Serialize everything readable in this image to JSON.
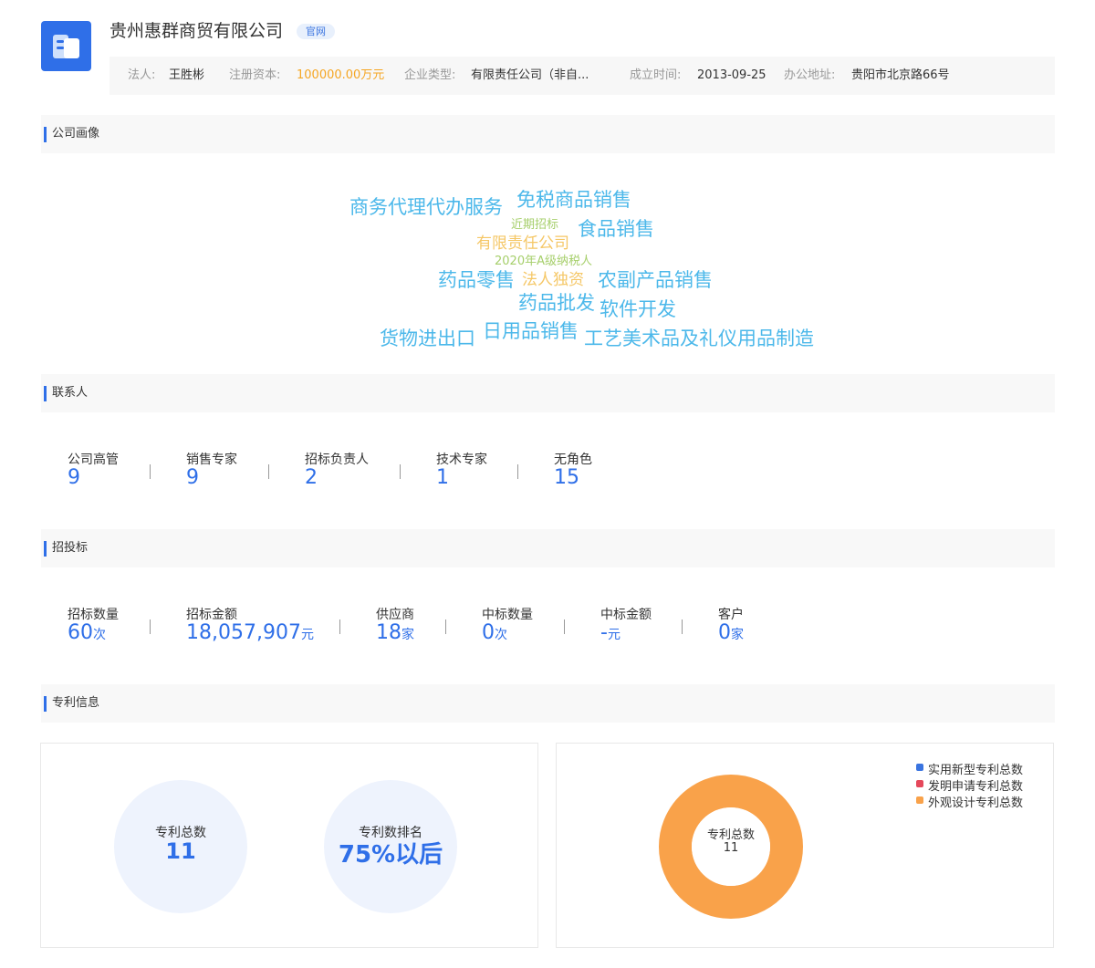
{
  "header": {
    "company_name": "贵州惠群商贸有限公司",
    "official_badge": "官网",
    "legal_person_label": "法人:",
    "legal_person": "王胜彬",
    "capital_label": "注册资本:",
    "capital": "100000.00万元",
    "type_label": "企业类型:",
    "type": "有限责任公司（非自...",
    "founded_label": "成立时间:",
    "founded": "2013-09-25",
    "address_label": "办公地址:",
    "address": "贵阳市北京路66号"
  },
  "portrait": {
    "title": "公司画像",
    "words": [
      {
        "text": "商务代理代办服务",
        "color": "#4cb8ea"
      },
      {
        "text": "免税商品销售",
        "color": "#4cb8ea"
      },
      {
        "text": "近期招标",
        "color": "#a6cf6b"
      },
      {
        "text": "食品销售",
        "color": "#4cb8ea"
      },
      {
        "text": "有限责任公司",
        "color": "#f5c766"
      },
      {
        "text": "2020年A级纳税人",
        "color": "#a6cf6b"
      },
      {
        "text": "药品零售",
        "color": "#4cb8ea"
      },
      {
        "text": "法人独资",
        "color": "#f5c766"
      },
      {
        "text": "农副产品销售",
        "color": "#4cb8ea"
      },
      {
        "text": "药品批发",
        "color": "#4cb8ea"
      },
      {
        "text": "软件开发",
        "color": "#4cb8ea"
      },
      {
        "text": "货物进出口",
        "color": "#4cb8ea"
      },
      {
        "text": "日用品销售",
        "color": "#4cb8ea"
      },
      {
        "text": "工艺美术品及礼仪用品制造",
        "color": "#4cb8ea"
      }
    ]
  },
  "contacts": {
    "title": "联系人",
    "items": [
      {
        "label": "公司高管",
        "value": "9"
      },
      {
        "label": "销售专家",
        "value": "9"
      },
      {
        "label": "招标负责人",
        "value": "2"
      },
      {
        "label": "技术专家",
        "value": "1"
      },
      {
        "label": "无角色",
        "value": "15"
      }
    ]
  },
  "bidding": {
    "title": "招投标",
    "items": [
      {
        "label": "招标数量",
        "value": "60",
        "unit": "次"
      },
      {
        "label": "招标金额",
        "value": "18,057,907",
        "unit": "元"
      },
      {
        "label": "供应商",
        "value": "18",
        "unit": "家"
      },
      {
        "label": "中标数量",
        "value": "0",
        "unit": "次"
      },
      {
        "label": "中标金额",
        "value": "-",
        "unit": "元"
      },
      {
        "label": "客户",
        "value": "0",
        "unit": "家"
      }
    ]
  },
  "patent": {
    "title": "专利信息",
    "total_label": "专利总数",
    "total_value": "11",
    "rank_label": "专利数排名",
    "rank_value": "75%以后",
    "donut_label": "专利总数",
    "donut_value": "11",
    "legend": [
      {
        "name": "实用新型专利总数",
        "color": "#3a74e0"
      },
      {
        "name": "发明申请专利总数",
        "color": "#e5485b"
      },
      {
        "name": "外观设计专利总数",
        "color": "#f9a24a"
      }
    ]
  }
}
